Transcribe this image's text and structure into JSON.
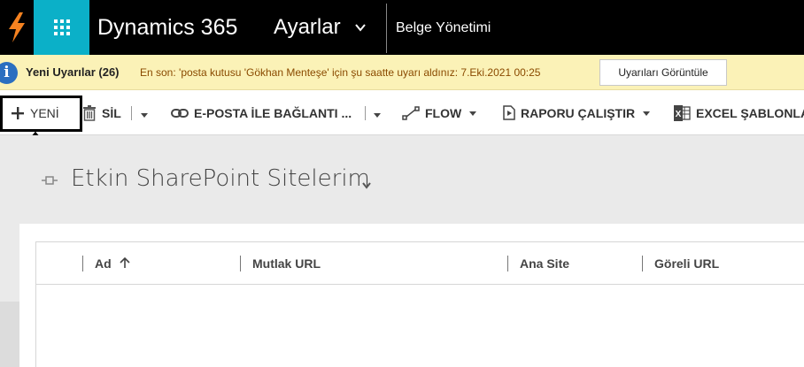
{
  "topbar": {
    "app_name": "Dynamics 365",
    "area_name": "Ayarlar",
    "sub_area": "Belge Yönetimi"
  },
  "notification": {
    "title": "Yeni Uyarılar (26)",
    "message": "En son: 'posta kutusu 'Gökhan Menteşe' için şu saatte uyarı aldınız: 7.Eki.2021 00:25",
    "button_label": "Uyarıları Görüntüle",
    "icon_glyph": "i"
  },
  "commands": {
    "new_label": "YENİ",
    "delete_label": "SİL",
    "email_link_label": "E-POSTA İLE BAĞLANTI ...",
    "flow_label": "FLOW",
    "run_report_label": "RAPORU ÇALIŞTIR",
    "excel_templates_label": "EXCEL ŞABLONLARI"
  },
  "view": {
    "title": "Etkin SharePoint Sitelerim"
  },
  "grid": {
    "columns": [
      "Ad",
      "Mutlak URL",
      "Ana Site",
      "Göreli URL"
    ],
    "sorted_column": "Ad",
    "sort_direction": "ascending"
  },
  "colors": {
    "topbar_bg": "#000000",
    "waffle_bg": "#0bb0c8",
    "notification_bg": "#fbf2b7",
    "content_bg": "#eaeaea"
  }
}
